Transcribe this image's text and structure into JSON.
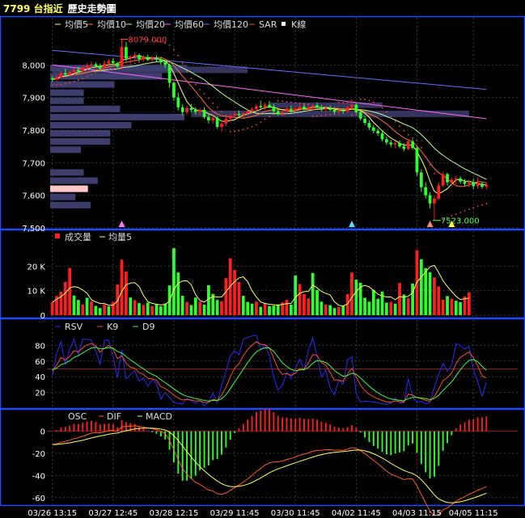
{
  "window": {
    "symbol": "7799 台指近",
    "subtitle": "歷史走勢圖"
  },
  "colors": {
    "up": "#ff1e1e",
    "down": "#2cff2c",
    "ma5": "#ffff66",
    "ma10": "#ff6a3a",
    "ma20": "#b8ff9a",
    "ma60": "#ff66ff",
    "ma120": "#6a6aff",
    "sar": "#ff4040",
    "grid": "#3a3a3a",
    "frame": "#1e4bff",
    "volume_profile": "#3d3d6e",
    "volume_profile_highlight": "#ffc8c8",
    "rsv": "#2a2aff",
    "k9": "#ff4a2a",
    "d9": "#3aff3a",
    "dif": "#ff5a1e",
    "macd": "#ffff55"
  },
  "chart_data": [
    {
      "type": "candlestick",
      "panel": "price",
      "legend": [
        {
          "key": "ma5",
          "label": "均價5"
        },
        {
          "key": "ma10",
          "label": "均價10"
        },
        {
          "key": "ma20",
          "label": "均價20"
        },
        {
          "key": "ma60",
          "label": "均價60"
        },
        {
          "key": "ma120",
          "label": "均價120"
        },
        {
          "key": "sar",
          "label": "SAR"
        },
        {
          "key": "kline",
          "label": "K線"
        }
      ],
      "ylim": [
        7500,
        8100
      ],
      "yticks": [
        7500,
        7600,
        7700,
        7800,
        7900,
        8000
      ],
      "ytick_labels": [
        "7,500",
        "7,600",
        "7,700",
        "7,800",
        "7,900",
        "8,000"
      ],
      "grid": true,
      "annotations": [
        {
          "text": "8079.000",
          "value": 8079,
          "index": 16,
          "kind": "high"
        },
        {
          "text": "7523.000",
          "value": 7523,
          "index": 88,
          "kind": "low"
        }
      ],
      "markers": [
        {
          "index": 16,
          "color": "#ff77ff"
        },
        {
          "index": 69,
          "color": "#55ddff"
        },
        {
          "index": 87,
          "color": "#ff8866"
        },
        {
          "index": 92,
          "color": "#ffff44"
        }
      ],
      "candles_ohlc": [
        [
          7958,
          7965,
          7948,
          7955
        ],
        [
          7955,
          7968,
          7950,
          7962
        ],
        [
          7962,
          7980,
          7958,
          7975
        ],
        [
          7975,
          7988,
          7965,
          7970
        ],
        [
          7970,
          7982,
          7966,
          7978
        ],
        [
          7978,
          7990,
          7972,
          7985
        ],
        [
          7985,
          7995,
          7975,
          7980
        ],
        [
          7980,
          7998,
          7978,
          7992
        ],
        [
          7992,
          8005,
          7985,
          7998
        ],
        [
          7998,
          8010,
          7990,
          8002
        ],
        [
          8002,
          8008,
          7992,
          7996
        ],
        [
          7996,
          8004,
          7985,
          7990
        ],
        [
          7990,
          8008,
          7986,
          8004
        ],
        [
          8004,
          8018,
          7998,
          8012
        ],
        [
          8012,
          8022,
          8000,
          8006
        ],
        [
          8006,
          8010,
          7990,
          7995
        ],
        [
          7995,
          8079,
          7990,
          8055
        ],
        [
          8055,
          8070,
          8010,
          8020
        ],
        [
          8020,
          8030,
          8005,
          8025
        ],
        [
          8025,
          8040,
          8015,
          8030
        ],
        [
          8030,
          8035,
          8012,
          8018
        ],
        [
          8018,
          8030,
          8010,
          8024
        ],
        [
          8024,
          8032,
          8012,
          8015
        ],
        [
          8015,
          8028,
          8008,
          8022
        ],
        [
          8022,
          8030,
          8010,
          8018
        ],
        [
          8018,
          8024,
          8000,
          8008
        ],
        [
          8008,
          8015,
          7990,
          8000
        ],
        [
          8000,
          8005,
          7930,
          7945
        ],
        [
          7945,
          7950,
          7890,
          7900
        ],
        [
          7900,
          7915,
          7860,
          7870
        ],
        [
          7870,
          7880,
          7845,
          7855
        ],
        [
          7855,
          7875,
          7848,
          7868
        ],
        [
          7868,
          7880,
          7855,
          7862
        ],
        [
          7862,
          7870,
          7848,
          7856
        ],
        [
          7856,
          7868,
          7845,
          7862
        ],
        [
          7862,
          7870,
          7835,
          7840
        ],
        [
          7840,
          7850,
          7820,
          7830
        ],
        [
          7830,
          7845,
          7820,
          7838
        ],
        [
          7838,
          7842,
          7805,
          7810
        ],
        [
          7810,
          7825,
          7795,
          7820
        ],
        [
          7820,
          7840,
          7812,
          7835
        ],
        [
          7835,
          7850,
          7828,
          7845
        ],
        [
          7845,
          7858,
          7836,
          7850
        ],
        [
          7850,
          7860,
          7840,
          7846
        ],
        [
          7846,
          7855,
          7838,
          7852
        ],
        [
          7852,
          7865,
          7845,
          7858
        ],
        [
          7858,
          7870,
          7850,
          7864
        ],
        [
          7864,
          7880,
          7858,
          7874
        ],
        [
          7874,
          7890,
          7866,
          7870
        ],
        [
          7870,
          7885,
          7862,
          7878
        ],
        [
          7878,
          7890,
          7866,
          7872
        ],
        [
          7872,
          7880,
          7850,
          7858
        ],
        [
          7858,
          7868,
          7845,
          7850
        ],
        [
          7850,
          7862,
          7842,
          7856
        ],
        [
          7856,
          7870,
          7850,
          7864
        ],
        [
          7864,
          7875,
          7852,
          7860
        ],
        [
          7860,
          7872,
          7854,
          7866
        ],
        [
          7866,
          7878,
          7858,
          7872
        ],
        [
          7872,
          7880,
          7860,
          7865
        ],
        [
          7865,
          7874,
          7856,
          7870
        ],
        [
          7870,
          7880,
          7862,
          7876
        ],
        [
          7876,
          7885,
          7866,
          7870
        ],
        [
          7870,
          7878,
          7858,
          7864
        ],
        [
          7864,
          7872,
          7855,
          7868
        ],
        [
          7868,
          7876,
          7858,
          7862
        ],
        [
          7862,
          7870,
          7850,
          7856
        ],
        [
          7856,
          7864,
          7846,
          7860
        ],
        [
          7860,
          7868,
          7850,
          7858
        ],
        [
          7858,
          7874,
          7852,
          7870
        ],
        [
          7870,
          7895,
          7864,
          7878
        ],
        [
          7878,
          7882,
          7850,
          7855
        ],
        [
          7855,
          7860,
          7830,
          7835
        ],
        [
          7835,
          7842,
          7815,
          7822
        ],
        [
          7822,
          7830,
          7800,
          7808
        ],
        [
          7808,
          7815,
          7790,
          7798
        ],
        [
          7798,
          7805,
          7782,
          7790
        ],
        [
          7790,
          7798,
          7765,
          7772
        ],
        [
          7772,
          7780,
          7755,
          7762
        ],
        [
          7762,
          7770,
          7748,
          7756
        ],
        [
          7756,
          7765,
          7745,
          7760
        ],
        [
          7760,
          7768,
          7744,
          7750
        ],
        [
          7750,
          7760,
          7735,
          7742
        ],
        [
          7742,
          7770,
          7738,
          7765
        ],
        [
          7765,
          7772,
          7740,
          7745
        ],
        [
          7745,
          7750,
          7660,
          7670
        ],
        [
          7670,
          7680,
          7610,
          7625
        ],
        [
          7625,
          7640,
          7590,
          7600
        ],
        [
          7600,
          7610,
          7560,
          7575
        ],
        [
          7575,
          7600,
          7523,
          7590
        ],
        [
          7590,
          7640,
          7585,
          7630
        ],
        [
          7630,
          7672,
          7625,
          7665
        ],
        [
          7665,
          7670,
          7630,
          7640
        ],
        [
          7640,
          7655,
          7628,
          7648
        ],
        [
          7648,
          7660,
          7635,
          7652
        ],
        [
          7652,
          7658,
          7636,
          7642
        ],
        [
          7642,
          7650,
          7628,
          7635
        ],
        [
          7635,
          7648,
          7625,
          7640
        ],
        [
          7640,
          7650,
          7618,
          7628
        ],
        [
          7628,
          7655,
          7620,
          7636
        ],
        [
          7636,
          7642,
          7620,
          7626
        ],
        [
          7626,
          7640,
          7618,
          7632
        ]
      ],
      "volume_profile": [
        {
          "price_low": 7980,
          "price_high": 8000,
          "length": 0.98
        },
        {
          "price_low": 7955,
          "price_high": 7975,
          "length": 0.8
        },
        {
          "price_low": 7930,
          "price_high": 7950,
          "length": 0.46
        },
        {
          "price_low": 7905,
          "price_high": 7925,
          "length": 0.24
        },
        {
          "price_low": 7880,
          "price_high": 7900,
          "length": 0.24
        },
        {
          "price_low": 7855,
          "price_high": 7875,
          "length": 0.5
        },
        {
          "price_low": 7830,
          "price_high": 7850,
          "length": 0.96
        },
        {
          "price_low": 7805,
          "price_high": 7825,
          "length": 0.58
        },
        {
          "price_low": 7780,
          "price_high": 7800,
          "length": 0.43
        },
        {
          "price_low": 7755,
          "price_high": 7775,
          "length": 0.43
        },
        {
          "price_low": 7730,
          "price_high": 7750,
          "length": 0.22
        },
        {
          "price_low": 7660,
          "price_high": 7680,
          "length": 0.24
        },
        {
          "price_low": 7635,
          "price_high": 7655,
          "length": 0.34
        },
        {
          "price_low": 7610,
          "price_high": 7630,
          "length": 0.27,
          "highlight": true
        },
        {
          "price_low": 7585,
          "price_high": 7605,
          "length": 0.18
        },
        {
          "price_low": 7560,
          "price_high": 7580,
          "length": 0.29
        }
      ],
      "price_bands": [
        {
          "price_low": 7975,
          "price_high": 7995,
          "start_index": 0,
          "end_index": 45
        },
        {
          "price_low": 7840,
          "price_high": 7860,
          "start_index": 32,
          "end_index": 96
        },
        {
          "price_low": 7868,
          "price_high": 7885,
          "start_index": 50,
          "end_index": 76
        }
      ]
    },
    {
      "type": "bar",
      "panel": "volume",
      "legend": [
        {
          "key": "volume",
          "label": "成交量"
        },
        {
          "key": "vol_ma5",
          "label": "均量5"
        }
      ],
      "ylim": [
        0,
        28000
      ],
      "yticks": [
        0,
        10000,
        20000
      ],
      "ytick_labels": [
        "0",
        "10 K",
        "20 K"
      ],
      "grid": true,
      "values": [
        5200,
        7800,
        9600,
        13500,
        19200,
        8000,
        6200,
        4400,
        7100,
        5600,
        3800,
        2900,
        4400,
        3600,
        5400,
        12500,
        22600,
        17800,
        7200,
        6100,
        4900,
        4200,
        5100,
        3700,
        4400,
        3600,
        4800,
        12100,
        27300,
        17400,
        7900,
        5400,
        4100,
        7200,
        5500,
        4300,
        12200,
        8700,
        6200,
        5700,
        15100,
        23200,
        18400,
        13500,
        7900,
        5400,
        4700,
        5500,
        3400,
        4900,
        3700,
        3900,
        4400,
        5200,
        6200,
        4300,
        16200,
        12700,
        8600,
        6800,
        17200,
        10300,
        5500,
        4300,
        4100,
        2900,
        3300,
        4000,
        8600,
        17400,
        14500,
        13200,
        7100,
        5500,
        10200,
        6700,
        9600,
        5100,
        5400,
        4700,
        13100,
        8400,
        6900,
        12900,
        26500,
        22800,
        19200,
        17500,
        15400,
        11700,
        6300,
        7800,
        6700,
        5900,
        5300,
        7600,
        9300
      ],
      "up_flags": [
        1,
        1,
        1,
        1,
        1,
        0,
        0,
        1,
        0,
        1,
        0,
        0,
        1,
        0,
        1,
        1,
        1,
        1,
        0,
        1,
        0,
        1,
        0,
        1,
        0,
        0,
        0,
        0,
        0,
        0,
        0,
        1,
        0,
        0,
        1,
        0,
        0,
        0,
        0,
        1,
        1,
        1,
        1,
        1,
        0,
        0,
        0,
        1,
        0,
        1,
        0,
        0,
        0,
        1,
        1,
        0,
        0,
        1,
        1,
        1,
        0,
        0,
        0,
        1,
        0,
        0,
        1,
        0,
        1,
        1,
        0,
        0,
        0,
        0,
        0,
        0,
        0,
        0,
        1,
        0,
        1,
        0,
        1,
        0,
        1,
        0,
        0,
        0,
        1,
        1,
        1,
        0,
        1,
        0,
        0,
        1,
        1
      ]
    },
    {
      "type": "line",
      "panel": "kd",
      "legend": [
        {
          "key": "rsv",
          "label": "RSV"
        },
        {
          "key": "k9",
          "label": "K9"
        },
        {
          "key": "d9",
          "label": "D9"
        }
      ],
      "ylim": [
        0,
        100
      ],
      "yticks": [
        20,
        40,
        60,
        80
      ],
      "ytick_labels": [
        "20",
        "40",
        "60",
        "80"
      ],
      "grid": true,
      "reference_line": 50
    },
    {
      "type": "bar",
      "panel": "macd",
      "legend": [
        {
          "key": "osc",
          "label": "OSC"
        },
        {
          "key": "dif",
          "label": "DIF"
        },
        {
          "key": "macd",
          "label": "MACD"
        }
      ],
      "ylim": [
        -66,
        10
      ],
      "yticks": [
        0,
        -20,
        -40,
        -60
      ],
      "ytick_labels": [
        "0",
        "-20",
        "-40",
        "-60"
      ],
      "grid": true
    }
  ],
  "x_axis": {
    "labels": [
      {
        "text": "03/26 13:15",
        "index": 0
      },
      {
        "text": "03/27 12:45",
        "index": 14
      },
      {
        "text": "03/28 12:15",
        "index": 28
      },
      {
        "text": "03/29 11:45",
        "index": 42
      },
      {
        "text": "03/30 11:45",
        "index": 56
      },
      {
        "text": "04/02 11:45",
        "index": 70
      },
      {
        "text": "04/03 11:15",
        "index": 84
      },
      {
        "text": "04/05 11:15",
        "index": 97
      }
    ]
  }
}
